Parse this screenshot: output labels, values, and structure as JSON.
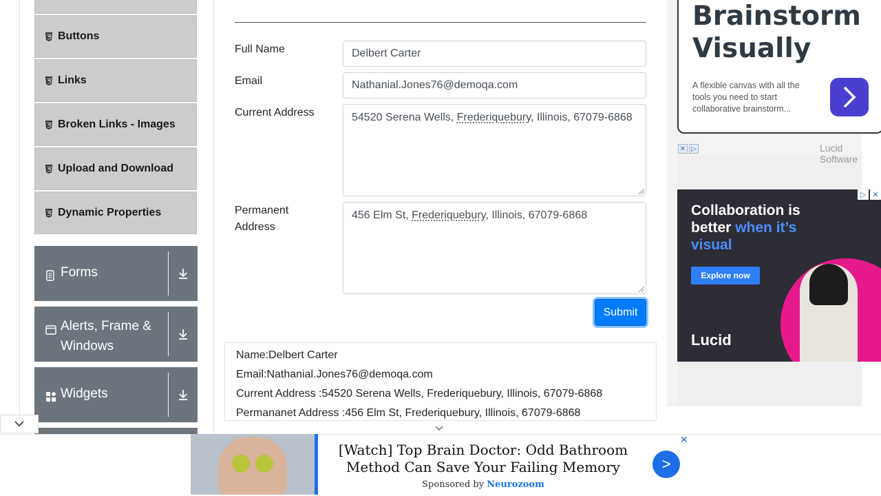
{
  "sidebar": {
    "elements_items": [
      {
        "label": "Buttons"
      },
      {
        "label": "Links"
      },
      {
        "label": "Broken Links - Images"
      },
      {
        "label": "Upload and Download"
      },
      {
        "label": "Dynamic Properties"
      }
    ],
    "groups": [
      {
        "label": "Forms",
        "icon": "document-icon"
      },
      {
        "label": "Alerts, Frame & Windows",
        "icon": "window-icon"
      },
      {
        "label": "Widgets",
        "icon": "widgets-icon"
      }
    ]
  },
  "form": {
    "full_name_label": "Full Name",
    "full_name_value": "Delbert Carter",
    "email_label": "Email",
    "email_value": "Nathanial.Jones76@demoqa.com",
    "current_address_label": "Current Address",
    "current_address_prefix": "54520 Serena Wells, ",
    "current_address_city": "Frederiquebury",
    "current_address_suffix": ", Illinois, 67079-6868",
    "permanent_address_label": "Permanent Address",
    "permanent_address_prefix": "456 Elm St, ",
    "permanent_address_city": "Frederiquebury",
    "permanent_address_suffix": ", Illinois, 67079-6868",
    "submit_label": "Submit"
  },
  "output": {
    "name": "Name:Delbert Carter",
    "email": "Email:Nathanial.Jones76@demoqa.com",
    "current_address": "Current Address :54520 Serena Wells, Frederiquebury, Illinois, 67079-6868",
    "permanent_address": "Permananet Address :456 Elm St, Frederiquebury, Illinois, 67079-6868"
  },
  "ads": {
    "headline": "Brainstorm Visually",
    "subtext": "A flexible canvas with all the tools you need to start collaborative brainstorm...",
    "brand_top": "Lucid Software",
    "banner_line1": "Collaboration is better ",
    "banner_line2": "when it’s visual",
    "banner_cta": "Explore now",
    "banner_logo": "Lucid"
  },
  "bottom_ad": {
    "title": "[Watch] Top Brain Doctor: Odd Bathroom Method Can Save Your Failing Memory",
    "sponsored_prefix": "Sponsored by ",
    "sponsor": "Neurozoom",
    "go_symbol": ">",
    "close_symbol": "✕"
  },
  "colors": {
    "primary": "#007bff",
    "sidebar_group": "#6c757d",
    "sidebar_item": "#cccccc"
  }
}
